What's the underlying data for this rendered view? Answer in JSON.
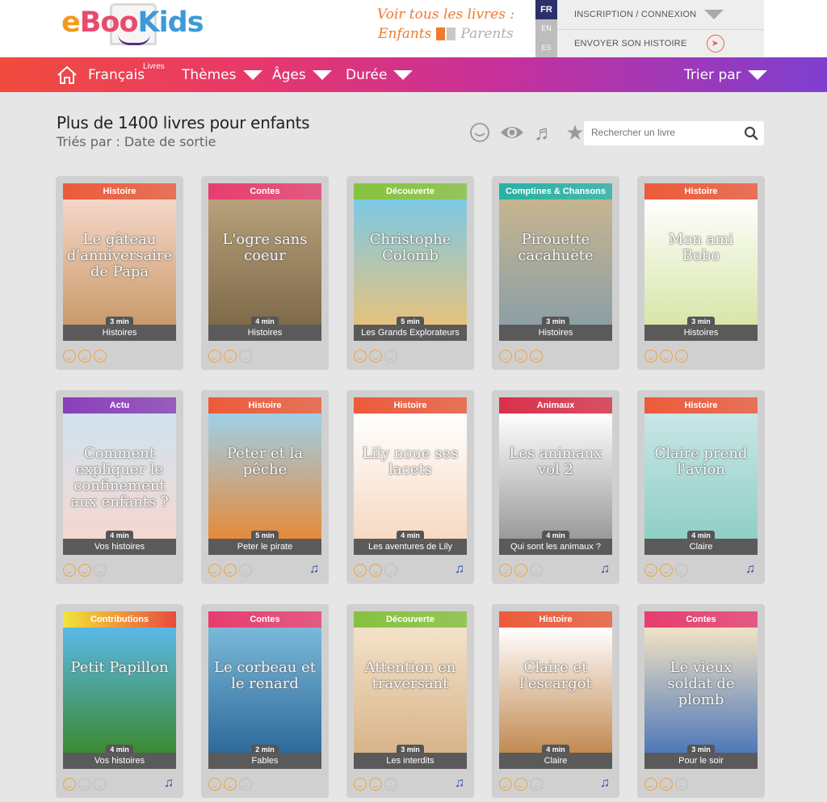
{
  "header": {
    "logo": {
      "e": "e",
      "boo": "Boo",
      "kids": "Kids"
    },
    "voir": {
      "title": "Voir tous les livres :",
      "kids": "Enfants",
      "parents": "Parents"
    },
    "languages": [
      "FR",
      "EN",
      "ES"
    ],
    "account": {
      "login": "INSCRIPTION / CONNEXION",
      "send": "ENVOYER SON HISTOIRE"
    }
  },
  "nav": {
    "home_icon": "home-icon",
    "language": "Français",
    "language_sup": "Livres",
    "themes": "Thèmes",
    "ages": "Âges",
    "duration": "Durée",
    "sort": "Trier par"
  },
  "section": {
    "title": "Plus de 1400 livres pour enfants",
    "subtitle": "Triés par : Date de sortie",
    "filter_icons": [
      "smile-icon",
      "eye-icon",
      "music-icon",
      "star-icon"
    ],
    "search_placeholder": "Rechercher un livre"
  },
  "colors": {
    "Histoire": "#ec5b3a",
    "Contes": "#e73d6f",
    "Découverte": "#86c23d",
    "Comptines & Chansons": "#27b1a6",
    "Actu": "#8a3fb9",
    "Animaux": "#d8314a",
    "Contributions": "#f0d22b",
    "accent": "#f07a2e"
  },
  "books": [
    {
      "category": "Histoire",
      "title": "Le gâteau d'anniversaire de Papa",
      "duration": "3 min",
      "series": "Histoires",
      "rating": 3,
      "music": false,
      "bg": [
        "#f5d7c9",
        "#c99a6a"
      ]
    },
    {
      "category": "Contes",
      "title": "L'ogre sans coeur",
      "duration": "4 min",
      "series": "Histoires",
      "rating": 2,
      "music": false,
      "bg": [
        "#b7a07a",
        "#7f6a4a"
      ]
    },
    {
      "category": "Découverte",
      "title": "Christophe Colomb",
      "duration": "5 min",
      "series": "Les Grands Explorateurs",
      "rating": 2,
      "music": false,
      "bg": [
        "#7cc9e6",
        "#e6c27d"
      ]
    },
    {
      "category": "Comptines & Chansons",
      "title": "Pirouette cacahuète",
      "duration": "3 min",
      "series": "Histoires",
      "rating": 3,
      "music": false,
      "bg": [
        "#c7b58f",
        "#8d9fa6"
      ]
    },
    {
      "category": "Histoire",
      "title": "Mon ami Bobo",
      "duration": "3 min",
      "series": "Histoires",
      "rating": 3,
      "music": false,
      "bg": [
        "#ffffff",
        "#d7e6a8"
      ]
    },
    {
      "category": "Actu",
      "title": "Comment expliquer le confinement aux enfants ?",
      "duration": "4 min",
      "series": "Vos histoires",
      "rating": 2,
      "music": false,
      "bg": [
        "#cfe3f0",
        "#f4d7cf"
      ]
    },
    {
      "category": "Histoire",
      "title": "Peter et la pêche",
      "duration": "5 min",
      "series": "Peter le pirate",
      "rating": 2,
      "music": true,
      "bg": [
        "#9fd0e8",
        "#e58a3a"
      ]
    },
    {
      "category": "Histoire",
      "title": "Lily noue ses lacets",
      "duration": "4 min",
      "series": "Les aventures de Lily",
      "rating": 2,
      "music": true,
      "bg": [
        "#ffffff",
        "#f6d9c3"
      ]
    },
    {
      "category": "Animaux",
      "title": "Les animaux vol 2",
      "duration": "4 min",
      "series": "Qui sont les animaux ?",
      "rating": 2,
      "music": true,
      "bg": [
        "#ffffff",
        "#9a9a9a"
      ]
    },
    {
      "category": "Histoire",
      "title": "Claire prend l'avion",
      "duration": "4 min",
      "series": "Claire",
      "rating": 2,
      "music": true,
      "bg": [
        "#c9e6e6",
        "#8fcfc6"
      ]
    },
    {
      "category": "Contributions",
      "title": "Petit Papillon",
      "duration": "4 min",
      "series": "Vos histoires",
      "rating": 1,
      "music": true,
      "bg": [
        "#5ab8e6",
        "#3c8a32"
      ]
    },
    {
      "category": "Contes",
      "title": "Le corbeau et le renard",
      "duration": "2 min",
      "series": "Fables",
      "rating": 2,
      "music": false,
      "bg": [
        "#7ab9d9",
        "#2f6a9a"
      ]
    },
    {
      "category": "Découverte",
      "title": "Attention en traversant",
      "duration": "3 min",
      "series": "Les interdits",
      "rating": 2,
      "music": true,
      "bg": [
        "#f3e2c9",
        "#d8b48a"
      ]
    },
    {
      "category": "Histoire",
      "title": "Claire et l'escargot",
      "duration": "4 min",
      "series": "Claire",
      "rating": 2,
      "music": true,
      "bg": [
        "#ffffff",
        "#c28a52"
      ]
    },
    {
      "category": "Contes",
      "title": "Le vieux soldat de plomb",
      "duration": "3 min",
      "series": "Pour le soir",
      "rating": 2,
      "music": false,
      "bg": [
        "#f2e3c4",
        "#4f78b8"
      ]
    }
  ]
}
